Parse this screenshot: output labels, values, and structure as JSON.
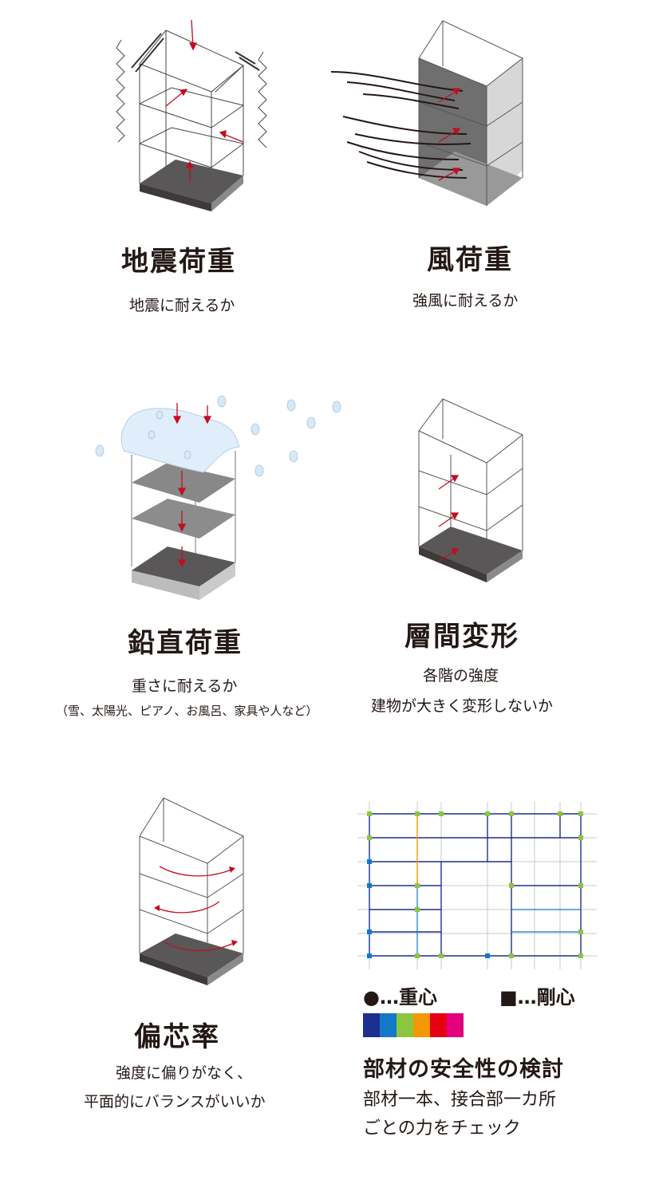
{
  "panels": {
    "seismic": {
      "title": "地震荷重",
      "caption": "地震に耐えるか"
    },
    "wind": {
      "title": "風荷重",
      "caption": "強風に耐えるか"
    },
    "vertical": {
      "title": "鉛直荷重",
      "caption": "重さに耐えるか",
      "note": "（雪、太陽光、ピアノ、お風呂、家具や人など）"
    },
    "drift": {
      "title": "層間変形",
      "caption_line1": "各階の強度",
      "caption_line2": "建物が大きく変形しないか"
    },
    "eccentricity": {
      "title": "偏芯率",
      "caption_line1": "強度に偏りがなく、",
      "caption_line2": "平面的にバランスがいいか"
    },
    "members": {
      "legend_center_of_gravity": "●…重心",
      "legend_center_of_rigidity": "■…剛心",
      "scale_colors": [
        "#1d2f8f",
        "#1278c8",
        "#8cc63f",
        "#f39800",
        "#e60012",
        "#e4007f"
      ],
      "title": "部材の安全性の検討",
      "caption_line1": "部材一本、接合部一カ所",
      "caption_line2": "ごとの力をチェック"
    }
  },
  "colors": {
    "arrow": "#c30d23",
    "floor_dark": "#595757",
    "floor_mid": "#7d7d7d",
    "text": "#231815"
  }
}
